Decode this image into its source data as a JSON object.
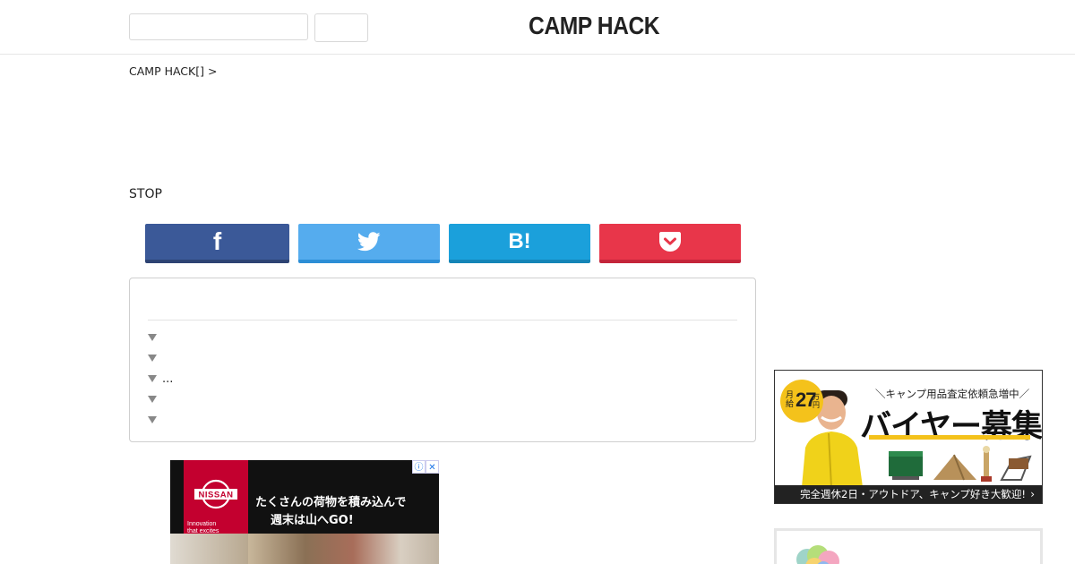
{
  "header": {
    "logo": "CAMP HACK",
    "search": {
      "placeholder": "",
      "button_label": ""
    }
  },
  "breadcrumb": "CAMP HACK[] >",
  "article": {
    "stop_text": "STOP"
  },
  "share": {
    "facebook_icon": "facebook-icon",
    "twitter_icon": "twitter-icon",
    "hatena_label": "B!",
    "pocket_icon": "pocket-icon"
  },
  "toc": {
    "title": "",
    "items": [
      "",
      "",
      "...",
      "",
      ""
    ]
  },
  "ad_left": {
    "brand": "NISSAN",
    "tagline_1": "Innovation",
    "tagline_2": "that excites",
    "copy_line_1": "たくさんの荷物を積み込んで",
    "copy_line_2": "週末は山へGO!",
    "info_icon": "ⓘ",
    "close_icon": "✕"
  },
  "ad_right": {
    "salary_prefix": "月給",
    "salary_amount": "27",
    "salary_unit": "万円",
    "subtitle": "＼キャンプ用品査定依頼急増中／",
    "title": "バイヤー募集",
    "footer": "完全週休2日・アウトドア、キャンプ好き大歓迎!",
    "chevron": "›"
  },
  "colors": {
    "facebook": "#3b5998",
    "twitter": "#55acee",
    "hatena": "#1ba0db",
    "pocket": "#e8364a",
    "nissan_red": "#c3002f",
    "salary_yellow": "#f4c21b"
  }
}
